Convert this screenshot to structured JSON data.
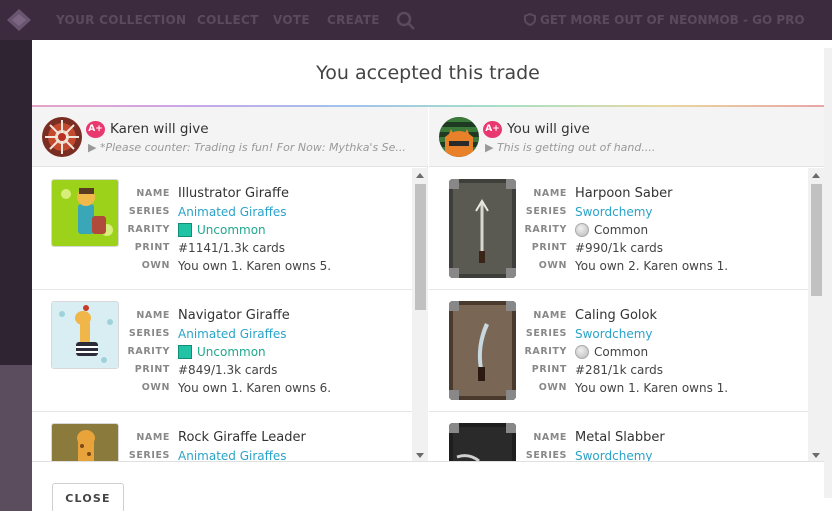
{
  "topnav": {
    "items": [
      "YOUR COLLECTION",
      "COLLECT",
      "VOTE",
      "CREATE"
    ],
    "promo": "GET MORE OUT OF NEONMOB - GO PRO"
  },
  "modal": {
    "title": "You accepted this trade",
    "close_label": "CLOSE"
  },
  "left": {
    "grade": "A+",
    "heading": "Karen will give",
    "note": "▶ *Please counter: Trading is fun! For Now: Mythka's Se...",
    "cards": [
      {
        "name": "Illustrator Giraffe",
        "series": "Animated Giraffes",
        "rarity": "Uncommon",
        "print": "#1141/1.3k cards",
        "own": "You own 1. Karen owns 5."
      },
      {
        "name": "Navigator Giraffe",
        "series": "Animated Giraffes",
        "rarity": "Uncommon",
        "print": "#849/1.3k cards",
        "own": "You own 1. Karen owns 6."
      },
      {
        "name": "Rock Giraffe Leader",
        "series": "Animated Giraffes"
      }
    ]
  },
  "right": {
    "grade": "A+",
    "heading": "You will give",
    "note": "▶ This is getting out of hand....",
    "cards": [
      {
        "name": "Harpoon Saber",
        "series": "Swordchemy",
        "rarity": "Common",
        "print": "#990/1k cards",
        "own": "You own 2. Karen owns 1."
      },
      {
        "name": "Caling Golok",
        "series": "Swordchemy",
        "rarity": "Common",
        "print": "#281/1k cards",
        "own": "You own 1. Karen owns 1."
      },
      {
        "name": "Metal Slabber",
        "series": "Swordchemy"
      }
    ]
  },
  "labels": {
    "name": "NAME",
    "series": "SERIES",
    "rarity": "RARITY",
    "print": "PRINT",
    "own": "OWN"
  },
  "colors": {
    "link": "#2aa3c9",
    "uncommon": "#1fa78e",
    "grade_badge": "#e8386f",
    "nav_bg": "#3c2b3f"
  }
}
